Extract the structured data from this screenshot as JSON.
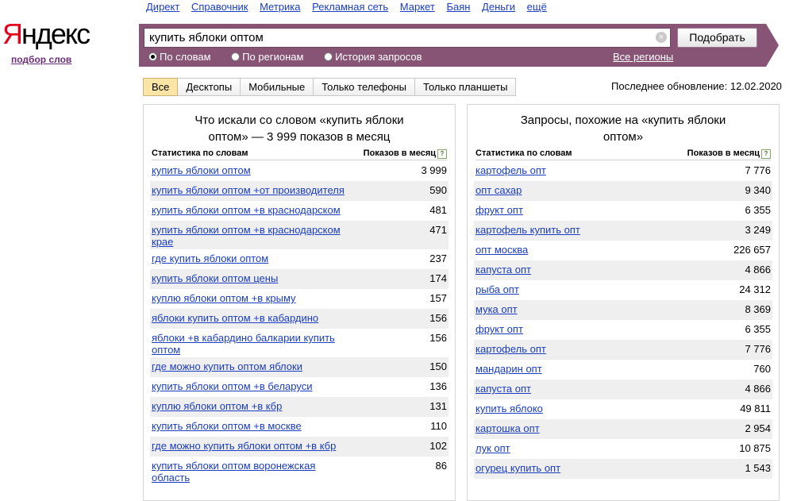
{
  "topnav": [
    "Директ",
    "Справочник",
    "Метрика",
    "Рекламная сеть",
    "Маркет",
    "Баян",
    "Деньги",
    "ещё"
  ],
  "logo": {
    "first": "Я",
    "rest": "ндекс"
  },
  "service": "подбор слов",
  "search": {
    "value": "купить яблоки оптом",
    "button": "Подобрать"
  },
  "radios": [
    "По словам",
    "По регионам",
    "История запросов"
  ],
  "regions": "Все регионы",
  "tabs": [
    "Все",
    "Десктопы",
    "Мобильные",
    "Только телефоны",
    "Только планшеты"
  ],
  "updated": "Последнее обновление: 12.02.2020",
  "left": {
    "title": "Что искали со словом «купить яблоки оптом» — 3 999 показов в месяц",
    "col1": "Статистика по словам",
    "col2": "Показов в месяц",
    "rows": [
      {
        "q": "купить яблоки оптом",
        "v": "3 999"
      },
      {
        "q": "купить яблоки оптом +от производителя",
        "v": "590"
      },
      {
        "q": "купить яблоки оптом +в краснодарском",
        "v": "481"
      },
      {
        "q": "купить яблоки оптом +в краснодарском крае",
        "v": "471"
      },
      {
        "q": "где купить яблоки оптом",
        "v": "237"
      },
      {
        "q": "купить яблоки оптом цены",
        "v": "174"
      },
      {
        "q": "куплю яблоки оптом +в крыму",
        "v": "157"
      },
      {
        "q": "яблоки купить оптом +в кабардино",
        "v": "156"
      },
      {
        "q": "яблоки +в кабардино балкарии купить оптом",
        "v": "156"
      },
      {
        "q": "где можно купить оптом яблоки",
        "v": "150"
      },
      {
        "q": "купить яблоки оптом +в беларуси",
        "v": "136"
      },
      {
        "q": "куплю яблоки оптом +в кбр",
        "v": "131"
      },
      {
        "q": "купить яблоки оптом +в москве",
        "v": "110"
      },
      {
        "q": "где можно купить яблоки оптом +в кбр",
        "v": "102"
      },
      {
        "q": "купить яблоки оптом воронежская область",
        "v": "86"
      }
    ]
  },
  "right": {
    "title": "Запросы, похожие на «купить яблоки оптом»",
    "col1": "Статистика по словам",
    "col2": "Показов в месяц",
    "rows": [
      {
        "q": "картофель опт",
        "v": "7 776"
      },
      {
        "q": "опт сахар",
        "v": "9 340"
      },
      {
        "q": "фрукт опт",
        "v": "6 355"
      },
      {
        "q": "картофель купить опт",
        "v": "3 249"
      },
      {
        "q": "опт москва",
        "v": "226 657"
      },
      {
        "q": "капуста опт",
        "v": "4 866"
      },
      {
        "q": "рыба опт",
        "v": "24 312"
      },
      {
        "q": "мука опт",
        "v": "8 369"
      },
      {
        "q": "фрукт опт",
        "v": "6 355"
      },
      {
        "q": "картофель опт",
        "v": "7 776"
      },
      {
        "q": "мандарин опт",
        "v": "760"
      },
      {
        "q": "капуста опт",
        "v": "4 866"
      },
      {
        "q": "купить яблоко",
        "v": "49 811"
      },
      {
        "q": "картошка опт",
        "v": "2 954"
      },
      {
        "q": "лук опт",
        "v": "10 875"
      },
      {
        "q": "огурец купить опт",
        "v": "1 543"
      }
    ]
  }
}
